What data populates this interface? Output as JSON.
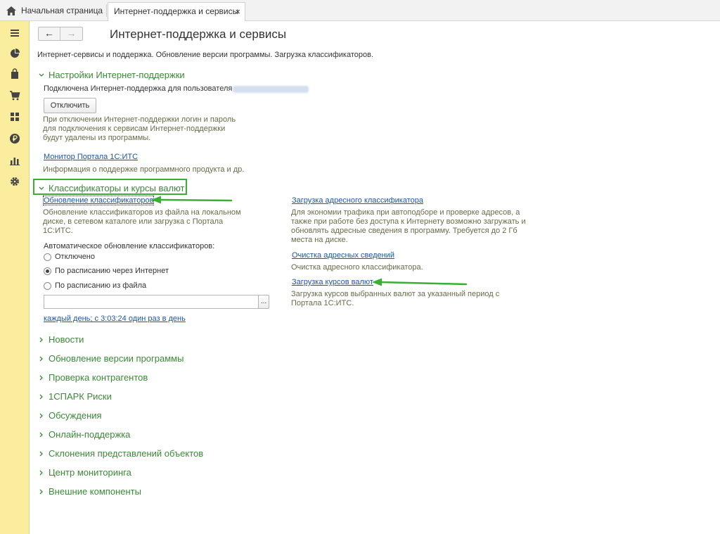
{
  "tabs": {
    "home_label": "Начальная страница",
    "active_label": "Интернет-поддержка и сервисы",
    "close_glyph": "×"
  },
  "sidebar": {
    "icons": [
      "menu-icon",
      "pie-chart-icon",
      "shopping-bag-icon",
      "cart-icon",
      "grid-icon",
      "ruble-icon",
      "bar-chart-icon",
      "gear-icon"
    ]
  },
  "nav": {
    "back": "←",
    "forward": "→"
  },
  "page": {
    "title": "Интернет-поддержка и сервисы",
    "subtitle": "Интернет-сервисы и поддержка. Обновление версии программы. Загрузка классификаторов."
  },
  "support_settings": {
    "header": "Настройки Интернет-поддержки",
    "connected_text": "Подключена Интернет-поддержка для пользователя",
    "disconnect_button": "Отключить",
    "disconnect_note": "При отключении Интернет-поддержки логин и пароль для подключения к сервисам Интернет-поддержки будут удалены из программы.",
    "portal_link": "Монитор Портала 1С:ИТС",
    "portal_note": "Информация о поддержке программного продукта и др."
  },
  "classifiers": {
    "header": "Классификаторы и курсы валют",
    "update_link": "Обновление классификаторов",
    "update_note": "Обновление классификаторов из файла на локальном диске, в сетевом каталоге или загрузка с Портала 1С:ИТС.",
    "auto_label": "Автоматическое обновление классификаторов:",
    "options": [
      "Отключено",
      "По расписанию через Интернет",
      "По расписанию из файла"
    ],
    "selected_option": 1,
    "file_button": "...",
    "schedule_link": "каждый день; с 3:03:24 один раз в день",
    "address_link": "Загрузка адресного классификатора",
    "address_note": "Для экономии трафика при автоподборе и проверке адресов, а также при работе без доступа к Интернету возможно загружать и обновлять адресные сведения в программу. Требуется до 2 Гб места на диске.",
    "clear_link": "Очистка адресных сведений",
    "clear_note": "Очистка адресного классификатора.",
    "rates_link": "Загрузка курсов валют",
    "rates_note": "Загрузка курсов выбранных валют за указанный период с Портала 1С:ИТС."
  },
  "collapsed_sections": [
    "Новости",
    "Обновление версии программы",
    "Проверка контрагентов",
    "1СПАРК Риски",
    "Обсуждения",
    "Онлайн-поддержка",
    "Склонения представлений объектов",
    "Центр мониторинга",
    "Внешние компоненты"
  ],
  "colors": {
    "accent_green": "#3ab032",
    "sidebar": "#fbed9e",
    "section_green": "#3a8a36",
    "link_blue": "#1a56a8"
  }
}
